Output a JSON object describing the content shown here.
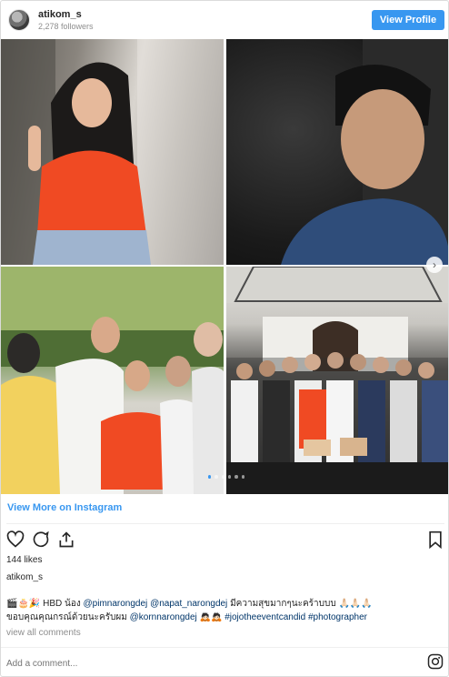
{
  "header": {
    "username": "atikom_s",
    "followers": "2,278 followers",
    "view_profile_label": "View Profile"
  },
  "carousel": {
    "dot_count": 6,
    "active_dot": 0
  },
  "footer": {
    "view_more_label": "View More on Instagram",
    "likes": "144 likes",
    "author": "atikom_s",
    "caption_line1_prefix": "🎬🎂🎉 HBD น้อง ",
    "caption_mention1": "@pimnarongdej",
    "caption_mention2": "@napat_narongdej",
    "caption_line1_suffix": " มีความสุขมากๆนะคร้าบบบ 🙏🏻🙏🏻🙏🏻",
    "caption_line2_prefix": "ขอบคุณคุณกรณ์ด้วยนะครับผม ",
    "caption_mention3": "@kornnarongdej",
    "caption_line2_mid": " 🙇🏻🙇🏻 ",
    "caption_hashtag1": "#jojotheeventcandid",
    "caption_hashtag2": "#photographer",
    "view_comments_label": "view all comments",
    "comment_placeholder": "Add a comment..."
  },
  "colors": {
    "accent": "#3897f0",
    "link": "#003569",
    "muted": "#8e8e8e"
  },
  "icons": {
    "like": "heart-icon",
    "comment": "comment-icon",
    "share": "share-icon",
    "save": "bookmark-icon",
    "brand": "instagram-icon",
    "next": "chevron-right-icon"
  }
}
